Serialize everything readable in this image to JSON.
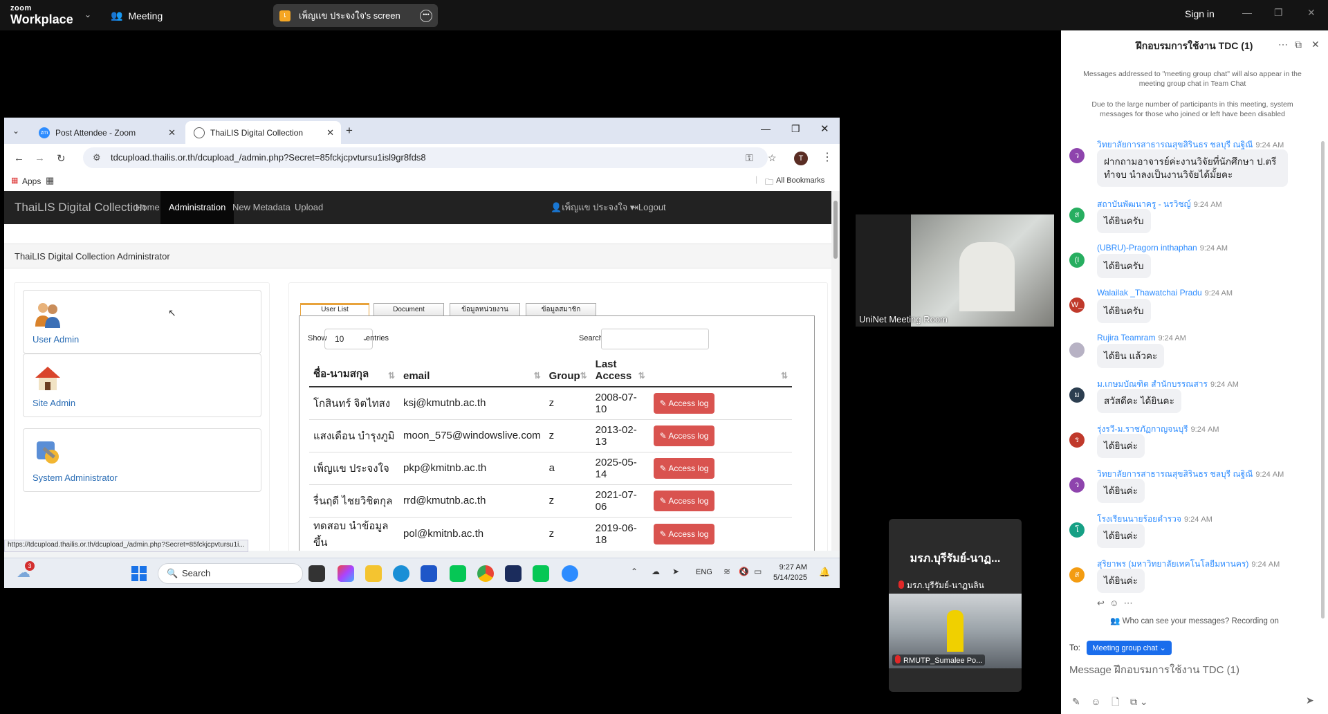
{
  "zoom": {
    "logo_line1": "zoom",
    "logo_line2": "Workplace",
    "meeting_label": "Meeting",
    "share_badge": "เ",
    "share_label": "เพ็ญแข ประจงใจ's screen",
    "sign_in": "Sign in"
  },
  "browser": {
    "tabs": [
      {
        "label": "Post Attendee - Zoom",
        "favicon": "zm",
        "favicon_color": "#2d8cff"
      },
      {
        "label": "ThaiLIS Digital Collection",
        "favicon": "globe-icon"
      }
    ],
    "url": "tdcupload.thailis.or.th/dcupload_/admin.php?Secret=85fckjcpvtursu1isl9gr8fds8",
    "profile_initial": "T",
    "bookmarks": {
      "apps": "Apps",
      "all": "All Bookmarks"
    },
    "status_url": "https://tdcupload.thailis.or.th/dcupload_/admin.php?Secret=85fckjcpvtursu1i..."
  },
  "app": {
    "brand": "ThaiLIS Digital Collection",
    "nav": [
      "Home",
      "Administration",
      "New Metadata",
      "Upload"
    ],
    "user_menu": "เพ็ญแข ประจงใจ",
    "logout": "Logout",
    "breadcrumb": "ThaiLIS Digital Collection Administrator",
    "cards": [
      "User Admin",
      "Site Admin",
      "System Administrator"
    ],
    "tabs": [
      "User List",
      "Document",
      "ข้อมูลหน่วยงาน",
      "ข้อมูลสมาชิก"
    ],
    "show_label": "Show",
    "entries_value": "10",
    "entries_label": "entries",
    "search_label": "Search:",
    "columns": [
      "ชื่อ-นามสกุล",
      "email",
      "Group",
      "Last Access",
      ""
    ],
    "action_label": "Access log",
    "rows": [
      {
        "name": "โกสินทร์ จิตไทสง",
        "email": "ksj@kmutnb.ac.th",
        "group": "z",
        "last": "2008-07-10"
      },
      {
        "name": "แสงเดือน บำรุงภูมิ",
        "email": "moon_575@windowslive.com",
        "group": "z",
        "last": "2013-02-13"
      },
      {
        "name": "เพ็ญแข ประจงใจ",
        "email": "pkp@kmitnb.ac.th",
        "group": "a",
        "last": "2025-05-14"
      },
      {
        "name": "รื่นฤดี ไชยวิชิตกุล",
        "email": "rrd@kmutnb.ac.th",
        "group": "z",
        "last": "2021-07-06"
      },
      {
        "name": "ทดสอบ นำข้อมูลขึ้น",
        "email": "pol@kmitnb.ac.th",
        "group": "z",
        "last": "2019-06-18"
      }
    ]
  },
  "taskbar": {
    "weather_badge": "3",
    "search": "Search",
    "lang": "ENG",
    "time": "9:27 AM",
    "date": "5/14/2025"
  },
  "videos": {
    "tile1_name": "UniNet Meeting Room",
    "tile2_title": "มรภ.บุรีรัมย์-นาฏ...",
    "tile2_sub": "มรภ.บุรีรัมย์-นาฏนลิน",
    "tile2_cam": "RMUTP_Sumalee Po..."
  },
  "chat": {
    "title": "ฝึกอบรมการใช้งาน TDC (1)",
    "notice1": "Messages addressed to \"meeting group chat\" will also appear in the meeting group chat in Team Chat",
    "notice2": "Due to the large number of participants in this meeting, system messages for those who joined or left have been disabled",
    "messages": [
      {
        "sender": "วิทยาลัยการสาธารณสุขสิรินธร ชลบุรี ณฐิณี",
        "time": "9:24 AM",
        "text": "ฝากถามอาจารย์ค่ะงานวิจัยที่นักศึกษา ป.ตรี ทำจบ นำลงเป็นงานวิจัยได้มั้ยคะ",
        "initial": "ว",
        "color": "#8e44ad"
      },
      {
        "sender": "สถาบันพัฒนาครู - นรวิชญ์",
        "time": "9:24 AM",
        "text": "ได้ยินครับ",
        "initial": "ส",
        "color": "#27ae60"
      },
      {
        "sender": "(UBRU)-Pragorn inthaphan",
        "time": "9:24 AM",
        "text": "ได้ยินครับ",
        "initial": "(I",
        "color": "#27ae60"
      },
      {
        "sender": "Walailak _Thawatchai Pradu",
        "time": "9:24 AM",
        "text": "ได้ยินครับ",
        "initial": "W_",
        "color": "#c0392b"
      },
      {
        "sender": "Rujira Teamram",
        "time": "9:24 AM",
        "text": "ได้ยิน แล้วคะ",
        "initial": "",
        "color": "#b7b2c4"
      },
      {
        "sender": "ม.เกษมบัณฑิต สำนักบรรณสาร",
        "time": "9:24 AM",
        "text": "สวัสดีคะ ได้ยินคะ",
        "initial": "ม",
        "color": "#2c3e50"
      },
      {
        "sender": "รุ่งรวี-ม.ราชภัฏกาญจนบุรี",
        "time": "9:24 AM",
        "text": "ได้ยินค่ะ",
        "initial": "ร",
        "color": "#c0392b"
      },
      {
        "sender": "วิทยาลัยการสาธารณสุขสิรินธร ชลบุรี ณฐิณี",
        "time": "9:24 AM",
        "text": "ได้ยินค่ะ",
        "initial": "ว",
        "color": "#8e44ad"
      },
      {
        "sender": "โรงเรียนนายร้อยตำรวจ",
        "time": "9:24 AM",
        "text": "ได้ยินค่ะ",
        "initial": "โ",
        "color": "#16a085"
      },
      {
        "sender": "สุริยาพร (มหาวิทยาลัยเทคโนโลยีมหานคร)",
        "time": "9:24 AM",
        "text": "ได้ยินค่ะ",
        "initial": "ส",
        "color": "#f39c12"
      }
    ],
    "who_can_see": "Who can see your messages? Recording on",
    "to_label": "To:",
    "to_target": "Meeting group chat",
    "placeholder": "Message ฝึกอบรมการใช้งาน TDC (1)"
  }
}
